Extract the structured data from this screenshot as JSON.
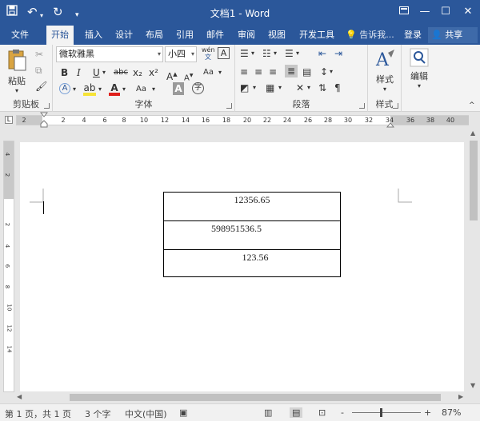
{
  "titlebar": {
    "title": "文档1 - Word",
    "save_icon": "save-icon",
    "undo_icon": "undo-icon",
    "redo_icon": "redo-icon",
    "customize_icon": "customize-quick-access-icon",
    "color": "#2b579a"
  },
  "menu": {
    "tabs": [
      "文件",
      "开始",
      "插入",
      "设计",
      "布局",
      "引用",
      "邮件",
      "审阅",
      "视图",
      "开发工具"
    ],
    "active": "开始",
    "tell_me": "告诉我...",
    "login": "登录",
    "share": "共享"
  },
  "ribbon": {
    "clipboard": {
      "label": "剪贴板",
      "paste": "粘贴"
    },
    "font": {
      "label": "字体",
      "font_name": "微软雅黑",
      "font_size": "小四",
      "pinyin": "wén",
      "border_char": "A",
      "bold": "B",
      "italic": "I",
      "underline": "U",
      "strike": "abc",
      "subscript": "x₂",
      "superscript": "x²",
      "grow": "A",
      "shrink": "A",
      "case": "Aa",
      "shade": "A",
      "circle": "字"
    },
    "paragraph": {
      "label": "段落"
    },
    "styles": {
      "label": "样式",
      "button": "样式"
    },
    "editing": {
      "button": "编辑"
    }
  },
  "ruler": {
    "h_ticks": [
      "2",
      "2",
      "4",
      "6",
      "8",
      "10",
      "12",
      "14",
      "16",
      "18",
      "20",
      "22",
      "24",
      "26",
      "28",
      "30",
      "32",
      "34",
      "36",
      "38",
      "40"
    ],
    "v_ticks": [
      "4",
      "2",
      "",
      "2",
      "4",
      "6",
      "8",
      "10",
      "12",
      "14"
    ]
  },
  "document": {
    "table": [
      {
        "value": "12356.65",
        "align": "center"
      },
      {
        "value": "598951536.5",
        "align": "left-ish"
      },
      {
        "value": "123.56",
        "align": "center"
      }
    ]
  },
  "status": {
    "page": "第 1 页，共 1 页",
    "words": "3 个字",
    "language": "中文(中国)",
    "zoom": "87%",
    "zoom_minus": "-",
    "zoom_plus": "+"
  }
}
